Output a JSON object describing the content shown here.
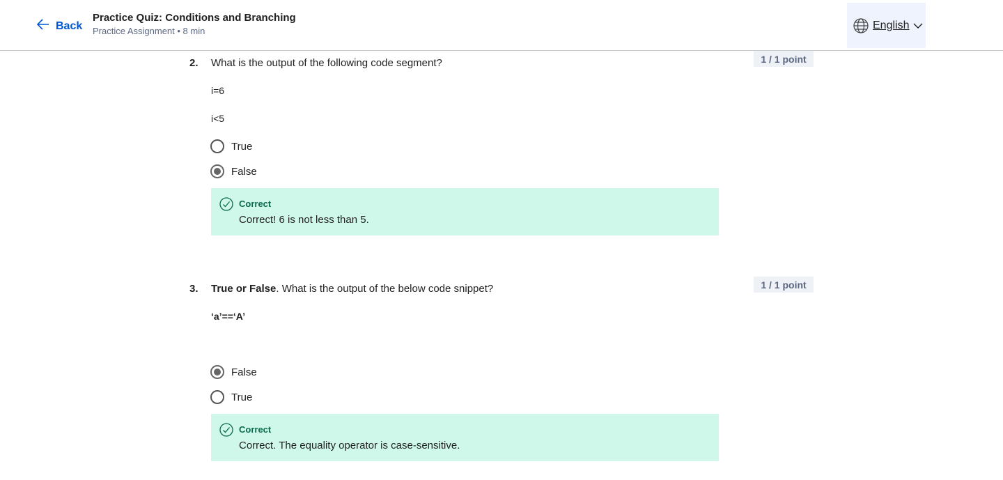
{
  "header": {
    "back_label": "Back",
    "title": "Practice Quiz: Conditions and Branching",
    "subtitle": "Practice Assignment • 8 min",
    "language": "English"
  },
  "questions": [
    {
      "number": "2.",
      "text": "What is the output of the following code segment?",
      "points": "1 / 1 point",
      "code": [
        "i=6",
        "i<5"
      ],
      "options": [
        {
          "label": "True",
          "selected": false
        },
        {
          "label": "False",
          "selected": true
        }
      ],
      "feedback": {
        "heading": "Correct",
        "text": "Correct! 6 is not less than 5."
      }
    },
    {
      "number": "3.",
      "text_bold": "True or False",
      "text_rest": ". What is the output of the below code snippet?",
      "points": "1 / 1 point",
      "code": [
        "‘a’==‘A’"
      ],
      "options": [
        {
          "label": "False",
          "selected": true
        },
        {
          "label": "True",
          "selected": false
        }
      ],
      "feedback": {
        "heading": "Correct",
        "text": "Correct. The equality operator is case-sensitive."
      }
    }
  ],
  "colors": {
    "accent": "#0056d2",
    "feedback_bg": "#cff8ea",
    "feedback_icon": "#0b6b4f",
    "points_bg": "#eef1f5"
  }
}
